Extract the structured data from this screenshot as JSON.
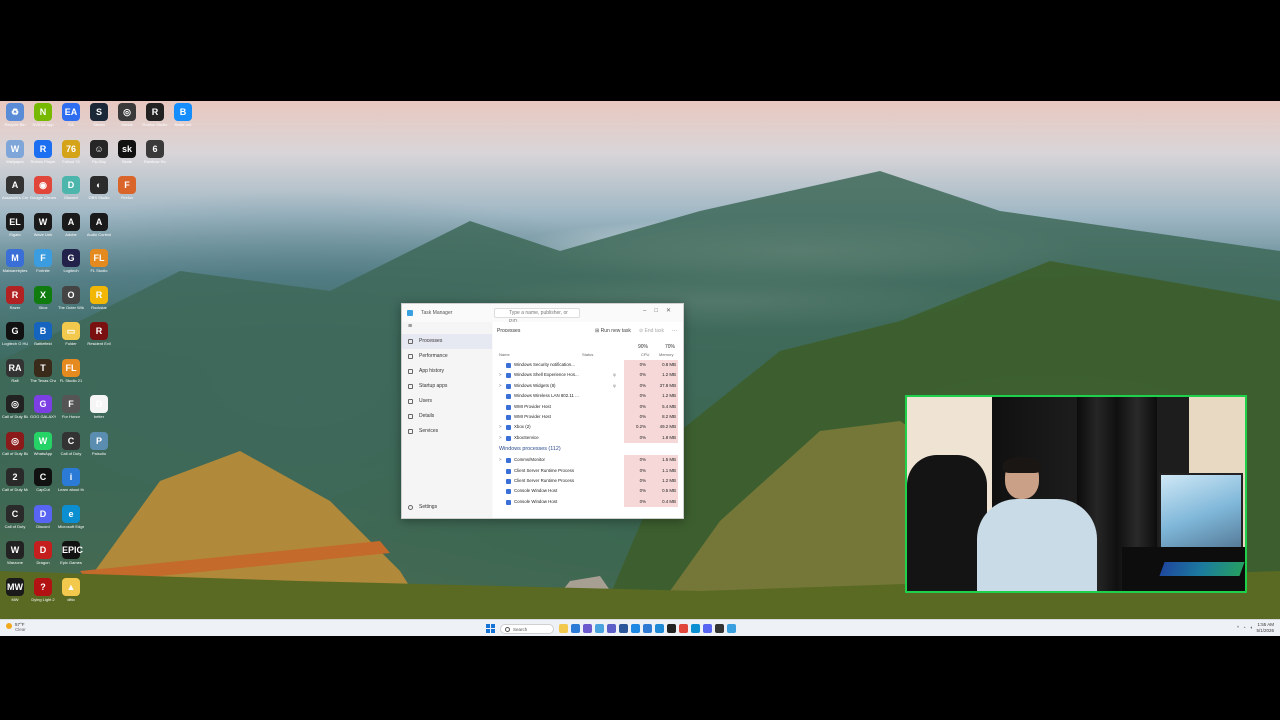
{
  "desktop": {
    "icons": [
      {
        "label": "Recycle Bin",
        "glyph": "♻",
        "color": "#5a8bd6",
        "col": 0,
        "row": 0
      },
      {
        "label": "NVIDIA App",
        "glyph": "N",
        "color": "#76b900",
        "col": 1,
        "row": 0
      },
      {
        "label": "EA",
        "glyph": "EA",
        "color": "#2e6cf0",
        "col": 2,
        "row": 0
      },
      {
        "label": "Steam",
        "glyph": "S",
        "color": "#1b2838",
        "col": 3,
        "row": 0
      },
      {
        "label": "Medal",
        "glyph": "◎",
        "color": "#3a3a3a",
        "col": 4,
        "row": 0
      },
      {
        "label": "Roblox Studio",
        "glyph": "R",
        "color": "#222222",
        "col": 5,
        "row": 0
      },
      {
        "label": "Battle.net",
        "glyph": "B",
        "color": "#148eff",
        "col": 6,
        "row": 0
      },
      {
        "label": "Wallpaper",
        "glyph": "W",
        "color": "#7fa6d8",
        "col": 0,
        "row": 1
      },
      {
        "label": "Roblox Player",
        "glyph": "R",
        "color": "#1d6ff2",
        "col": 1,
        "row": 1
      },
      {
        "label": "Fallout 76",
        "glyph": "76",
        "color": "#d4a317",
        "col": 2,
        "row": 1
      },
      {
        "label": "Pip-Boy",
        "glyph": "☺",
        "color": "#262626",
        "col": 3,
        "row": 1
      },
      {
        "label": "Skate",
        "glyph": "sk",
        "color": "#111111",
        "col": 4,
        "row": 1
      },
      {
        "label": "Rainbow Six",
        "glyph": "6",
        "color": "#3a3a3a",
        "col": 5,
        "row": 1
      },
      {
        "label": "Assassin's Creed",
        "glyph": "A",
        "color": "#333333",
        "col": 0,
        "row": 2
      },
      {
        "label": "Google Chrome",
        "glyph": "◉",
        "color": "#e0473a",
        "col": 1,
        "row": 2
      },
      {
        "label": "Discord",
        "glyph": "D",
        "color": "#4db6ac",
        "col": 2,
        "row": 2
      },
      {
        "label": "OBS Studio",
        "glyph": "◐",
        "color": "#2b2b2b",
        "col": 3,
        "row": 2
      },
      {
        "label": "Firefox",
        "glyph": "F",
        "color": "#d9652b",
        "col": 4,
        "row": 2
      },
      {
        "label": "Elgato",
        "glyph": "EL",
        "color": "#1a1a1a",
        "col": 0,
        "row": 3
      },
      {
        "label": "Wave Link",
        "glyph": "W",
        "color": "#1a1a1a",
        "col": 1,
        "row": 3
      },
      {
        "label": "Adobe",
        "glyph": "A",
        "color": "#1a1a1a",
        "col": 2,
        "row": 3
      },
      {
        "label": "Audio Control",
        "glyph": "A",
        "color": "#1a1a1a",
        "col": 3,
        "row": 3
      },
      {
        "label": "Malwarebytes",
        "glyph": "M",
        "color": "#3a6fd8",
        "col": 0,
        "row": 4
      },
      {
        "label": "Fortnite",
        "glyph": "F",
        "color": "#3b9de0",
        "col": 1,
        "row": 4
      },
      {
        "label": "Logitech",
        "glyph": "G",
        "color": "#22224a",
        "col": 2,
        "row": 4
      },
      {
        "label": "FL Studio",
        "glyph": "FL",
        "color": "#e58a1f",
        "col": 3,
        "row": 4
      },
      {
        "label": "Razer",
        "glyph": "R",
        "color": "#b22222",
        "col": 0,
        "row": 5
      },
      {
        "label": "Xbox",
        "glyph": "X",
        "color": "#107c10",
        "col": 1,
        "row": 5
      },
      {
        "label": "The Outer Wilds",
        "glyph": "O",
        "color": "#444444",
        "col": 2,
        "row": 5
      },
      {
        "label": "Rockstar",
        "glyph": "R",
        "color": "#f2b705",
        "col": 3,
        "row": 5
      },
      {
        "label": "Logitech G HUB",
        "glyph": "G",
        "color": "#111111",
        "col": 0,
        "row": 6
      },
      {
        "label": "Battlefield",
        "glyph": "B",
        "color": "#1565c0",
        "col": 1,
        "row": 6
      },
      {
        "label": "Folder",
        "glyph": "▭",
        "color": "#f2c94c",
        "col": 2,
        "row": 6
      },
      {
        "label": "Resident Evil",
        "glyph": "R",
        "color": "#7a1010",
        "col": 3,
        "row": 6
      },
      {
        "label": "Raft",
        "glyph": "RA",
        "color": "#333333",
        "col": 0,
        "row": 7
      },
      {
        "label": "The Texas Chain Saw",
        "glyph": "T",
        "color": "#3a2a1a",
        "col": 1,
        "row": 7
      },
      {
        "label": "FL Studio 21",
        "glyph": "FL",
        "color": "#e58a1f",
        "col": 2,
        "row": 7
      },
      {
        "label": "Call of Duty Black Ops",
        "glyph": "◎",
        "color": "#222222",
        "col": 0,
        "row": 8
      },
      {
        "label": "GOG GALAXY",
        "glyph": "G",
        "color": "#7b3fe4",
        "col": 1,
        "row": 8
      },
      {
        "label": "For Honor",
        "glyph": "F",
        "color": "#555555",
        "col": 2,
        "row": 8
      },
      {
        "label": "better",
        "glyph": "D",
        "color": "#f5f5f5",
        "col": 3,
        "row": 8
      },
      {
        "label": "Call of Duty Black Ops",
        "glyph": "◎",
        "color": "#8b1a1a",
        "col": 0,
        "row": 9
      },
      {
        "label": "WhatsApp",
        "glyph": "W",
        "color": "#25d366",
        "col": 1,
        "row": 9
      },
      {
        "label": "Call of Duty",
        "glyph": "C",
        "color": "#333333",
        "col": 2,
        "row": 9
      },
      {
        "label": "Palsolio",
        "glyph": "P",
        "color": "#5b8db0",
        "col": 3,
        "row": 9
      },
      {
        "label": "Call of Duty Modern",
        "glyph": "2",
        "color": "#2a2a2a",
        "col": 0,
        "row": 10
      },
      {
        "label": "CapCut",
        "glyph": "C",
        "color": "#111111",
        "col": 1,
        "row": 10
      },
      {
        "label": "Learn about this picture",
        "glyph": "i",
        "color": "#2b7bd6",
        "col": 2,
        "row": 10
      },
      {
        "label": "Call of Duty",
        "glyph": "C",
        "color": "#2a2a2a",
        "col": 0,
        "row": 11
      },
      {
        "label": "Discord",
        "glyph": "D",
        "color": "#5865f2",
        "col": 1,
        "row": 11
      },
      {
        "label": "Microsoft Edge",
        "glyph": "e",
        "color": "#0c8fd1",
        "col": 2,
        "row": 11
      },
      {
        "label": "Warzone",
        "glyph": "W",
        "color": "#222222",
        "col": 0,
        "row": 12
      },
      {
        "label": "Dragon",
        "glyph": "D",
        "color": "#c41e1e",
        "col": 1,
        "row": 12
      },
      {
        "label": "Epic Games",
        "glyph": "EPIC",
        "color": "#111111",
        "col": 2,
        "row": 12
      },
      {
        "label": "MW",
        "glyph": "MW",
        "color": "#1a1a1a",
        "col": 0,
        "row": 13
      },
      {
        "label": "Dying Light 2",
        "glyph": "?",
        "color": "#b31212",
        "col": 1,
        "row": 13
      },
      {
        "label": "ditto",
        "glyph": "▲",
        "color": "#f2c94c",
        "col": 2,
        "row": 13
      }
    ]
  },
  "task_manager": {
    "app_title": "Task Manager",
    "search_placeholder": "Type a name, publisher, or PID...",
    "nav": [
      {
        "label": "Processes",
        "active": true
      },
      {
        "label": "Performance",
        "active": false
      },
      {
        "label": "App history",
        "active": false
      },
      {
        "label": "Startup apps",
        "active": false
      },
      {
        "label": "Users",
        "active": false
      },
      {
        "label": "Details",
        "active": false
      },
      {
        "label": "Services",
        "active": false
      }
    ],
    "settings_label": "Settings",
    "page_title": "Processes",
    "run_new_task": "Run new task",
    "end_task": "End task",
    "columns": {
      "name": "Name",
      "status": "Status",
      "cpu_pct": "90%",
      "cpu": "CPU",
      "mem_pct": "70%",
      "memory": "Memory"
    },
    "rows": [
      {
        "name": "Windows Security notification...",
        "status": "",
        "cpu": "0%",
        "mem": "0.8 MB",
        "exp": ""
      },
      {
        "name": "Windows Shell Experience Hos...",
        "status": "φ",
        "cpu": "0%",
        "mem": "1.2 MB",
        "exp": ">"
      },
      {
        "name": "Windows Widgets (8)",
        "status": "φ",
        "cpu": "0%",
        "mem": "37.8 MB",
        "exp": ">"
      },
      {
        "name": "Windows Wireless LAN 802.11 ...",
        "status": "",
        "cpu": "0%",
        "mem": "1.2 MB",
        "exp": ""
      },
      {
        "name": "WMI Provider Host",
        "status": "",
        "cpu": "0%",
        "mem": "5.4 MB",
        "exp": ""
      },
      {
        "name": "WMI Provider Host",
        "status": "",
        "cpu": "0%",
        "mem": "8.2 MB",
        "exp": ""
      },
      {
        "name": "Xbox (2)",
        "status": "",
        "cpu": "0.2%",
        "mem": "49.2 MB",
        "exp": ">"
      },
      {
        "name": "XboxService",
        "status": "",
        "cpu": "0%",
        "mem": "1.8 MB",
        "exp": ">"
      }
    ],
    "section_label": "Windows processes (112)",
    "rows2": [
      {
        "name": "Comms/Monitor",
        "cpu": "0%",
        "mem": "1.5 MB",
        "exp": ">"
      },
      {
        "name": "Client Server Runtime Process",
        "cpu": "0%",
        "mem": "1.1 MB",
        "exp": ""
      },
      {
        "name": "Client Server Runtime Process",
        "cpu": "0%",
        "mem": "1.2 MB",
        "exp": ""
      },
      {
        "name": "Console Window Host",
        "cpu": "0%",
        "mem": "0.5 MB",
        "exp": ""
      },
      {
        "name": "Console Window Host",
        "cpu": "0%",
        "mem": "0.4 MB",
        "exp": ""
      }
    ]
  },
  "taskbar": {
    "weather_temp": "57°F",
    "weather_text": "Clear",
    "search_label": "Search",
    "pinned": [
      {
        "name": "file-explorer-icon",
        "color": "#f2c94c"
      },
      {
        "name": "browser-icon",
        "color": "#2b7bd6"
      },
      {
        "name": "store-icon",
        "color": "#6a5acd"
      },
      {
        "name": "mail-icon",
        "color": "#4aa3df"
      },
      {
        "name": "teams-icon",
        "color": "#5b5fc7"
      },
      {
        "name": "word-icon",
        "color": "#2b579a"
      },
      {
        "name": "photos-icon",
        "color": "#1e88e5"
      },
      {
        "name": "calendar-icon",
        "color": "#2f7bd3"
      },
      {
        "name": "vscode-icon",
        "color": "#1e8ad6"
      },
      {
        "name": "music-icon",
        "color": "#222222"
      },
      {
        "name": "chrome-icon",
        "color": "#e0473a"
      },
      {
        "name": "edge-icon",
        "color": "#0c8fd1"
      },
      {
        "name": "discord-icon",
        "color": "#5865f2"
      },
      {
        "name": "obs-icon",
        "color": "#333333"
      },
      {
        "name": "taskmanager-icon",
        "color": "#3aa0e0"
      }
    ],
    "time": "1:55 AM",
    "date": "5/1/2026"
  }
}
